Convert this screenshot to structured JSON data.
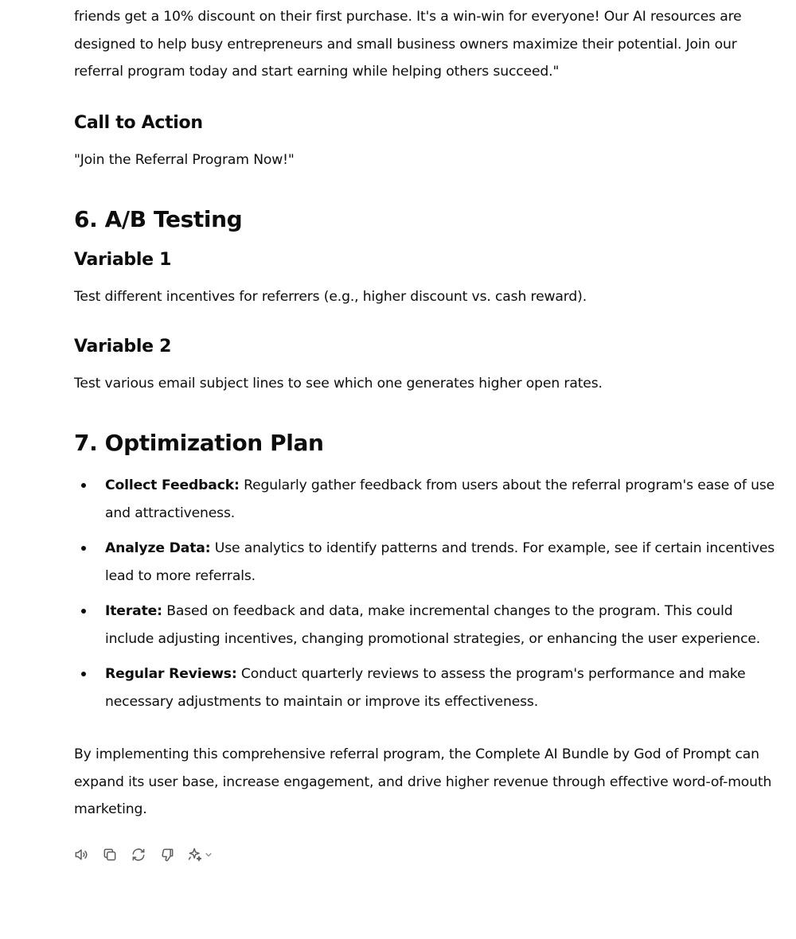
{
  "intro": {
    "text": "friends get a 10% discount on their first purchase. It's a win-win for everyone! Our AI resources are designed to help busy entrepreneurs and small business owners maximize their potential. Join our referral program today and start earning while helping others succeed.\""
  },
  "cta": {
    "heading": "Call to Action",
    "text": "\"Join the Referral Program Now!\""
  },
  "ab_testing": {
    "heading": "6. A/B Testing",
    "variables": [
      {
        "heading": "Variable 1",
        "text": "Test different incentives for referrers (e.g., higher discount vs. cash reward)."
      },
      {
        "heading": "Variable 2",
        "text": "Test various email subject lines to see which one generates higher open rates."
      }
    ]
  },
  "optimization": {
    "heading": "7. Optimization Plan",
    "items": [
      {
        "label": "Collect Feedback:",
        "text": " Regularly gather feedback from users about the referral program's ease of use and attractiveness."
      },
      {
        "label": "Analyze Data:",
        "text": " Use analytics to identify patterns and trends. For example, see if certain incentives lead to more referrals."
      },
      {
        "label": "Iterate:",
        "text": " Based on feedback and data, make incremental changes to the program. This could include adjusting incentives, changing promotional strategies, or enhancing the user experience."
      },
      {
        "label": "Regular Reviews:",
        "text": " Conduct quarterly reviews to assess the program's performance and make necessary adjustments to maintain or improve its effectiveness."
      }
    ]
  },
  "conclusion": {
    "text": "By implementing this comprehensive referral program, the Complete AI Bundle by God of Prompt can expand its user base, increase engagement, and drive higher revenue through effective word-of-mouth marketing."
  },
  "toolbar": {
    "icons": [
      "read-aloud-icon",
      "copy-icon",
      "regenerate-icon",
      "thumbs-down-icon",
      "sparkle-icon",
      "chevron-down-icon"
    ],
    "icon_color": "#5d5d5d"
  }
}
